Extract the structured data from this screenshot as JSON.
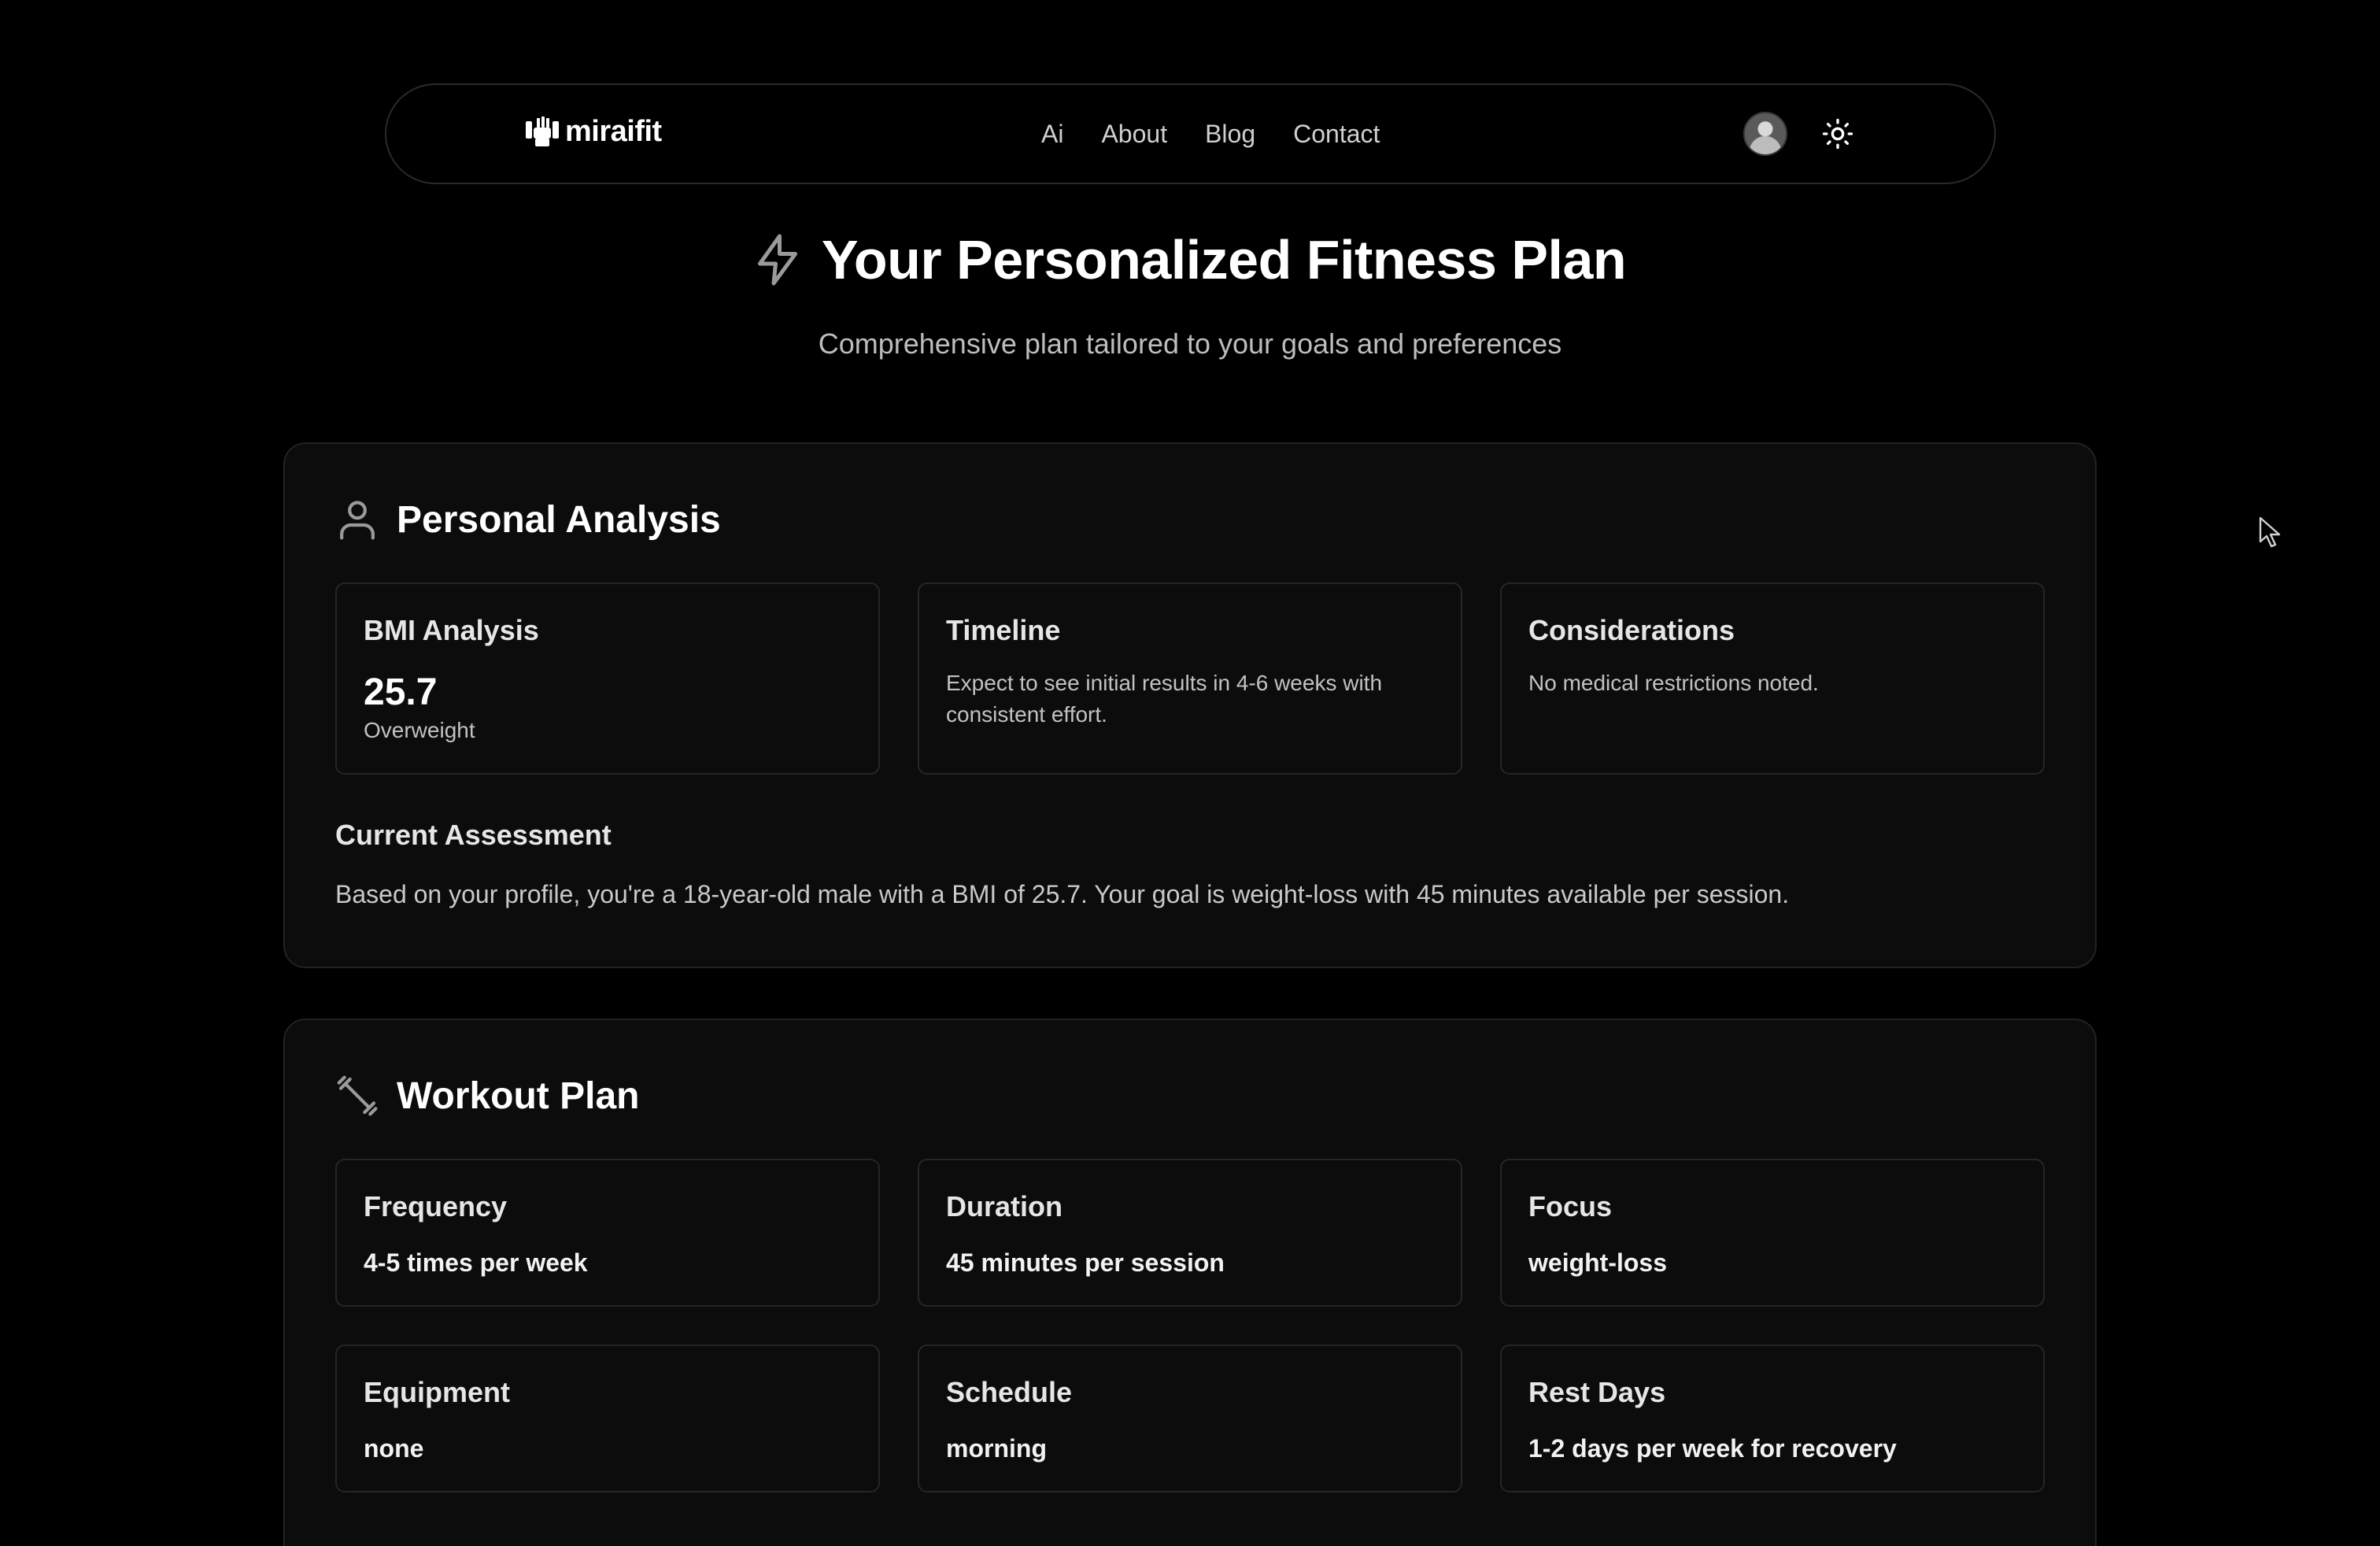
{
  "nav": {
    "logo_text": "miraifit",
    "links": [
      "Ai",
      "About",
      "Blog",
      "Contact"
    ]
  },
  "hero": {
    "title": "Your Personalized Fitness Plan",
    "subtitle": "Comprehensive plan tailored to your goals and preferences"
  },
  "analysis": {
    "title": "Personal Analysis",
    "bmi": {
      "title": "BMI Analysis",
      "value": "25.7",
      "category": "Overweight"
    },
    "timeline": {
      "title": "Timeline",
      "text": "Expect to see initial results in 4-6 weeks with consistent effort."
    },
    "considerations": {
      "title": "Considerations",
      "text": "No medical restrictions noted."
    },
    "assessment": {
      "title": "Current Assessment",
      "text": "Based on your profile, you're a 18-year-old male with a BMI of 25.7. Your goal is weight-loss with 45 minutes available per session."
    }
  },
  "workout": {
    "title": "Workout Plan",
    "cards": [
      {
        "title": "Frequency",
        "value": "4-5 times per week"
      },
      {
        "title": "Duration",
        "value": "45 minutes per session"
      },
      {
        "title": "Focus",
        "value": "weight-loss"
      },
      {
        "title": "Equipment",
        "value": "none"
      },
      {
        "title": "Schedule",
        "value": "morning"
      },
      {
        "title": "Rest Days",
        "value": "1-2 days per week for recovery"
      }
    ]
  },
  "colors": {
    "background": "#000000",
    "panel": "#0c0c0c",
    "border": "#222222",
    "text": "#ffffff",
    "muted": "#bdbdbd"
  },
  "icons": {
    "hero": "lightning-icon",
    "analysis": "user-icon",
    "workout": "dumbbell-icon",
    "theme": "sun-icon"
  }
}
